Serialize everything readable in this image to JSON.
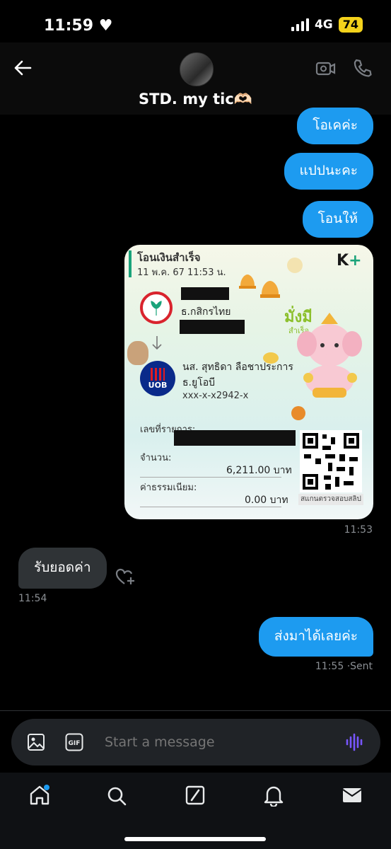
{
  "status": {
    "time": "11:59",
    "network": "4G",
    "battery": "74"
  },
  "header": {
    "title": "STD. my tic🫶🏻"
  },
  "messages": {
    "out1": "โอเคค่ะ",
    "out2": "แปปนะคะ",
    "out3": "โอนให้",
    "slip_time": "11:53",
    "in1": "รับยอดค่า",
    "in1_time": "11:54",
    "out4": "ส่งมาได้เลยค่ะ",
    "out4_time": "11:55",
    "out4_status": "·Sent"
  },
  "slip": {
    "title": "โอนเงินสำเร็จ",
    "date": "11 พ.ค. 67  11:53 น.",
    "brand": "K+",
    "from_bank": "ธ.กสิกรไทย",
    "to_name": "นส. สุทธิดา ลือชาประการ",
    "to_bank": "ธ.ยูโอบี",
    "to_account": "xxx-x-x2942-x",
    "ref_label": "เลขที่รายการ:",
    "amount_label": "จำนวน:",
    "amount": "6,211.00 บาท",
    "fee_label": "ค่าธรรมเนียม:",
    "fee": "0.00 บาท",
    "qr_caption": "สแกนตรวจสอบสลิป",
    "uob": "UOB",
    "sticker_text": "มั่งมี",
    "sticker_sub": "สำเร็จ"
  },
  "composer": {
    "placeholder": "Start a message"
  },
  "icons": [
    "back-arrow-icon",
    "video-call-icon",
    "phone-icon",
    "image-icon",
    "gif-icon",
    "voice-icon",
    "home-icon",
    "search-icon",
    "grok-icon",
    "bell-icon",
    "mail-icon",
    "add-reaction-icon"
  ]
}
